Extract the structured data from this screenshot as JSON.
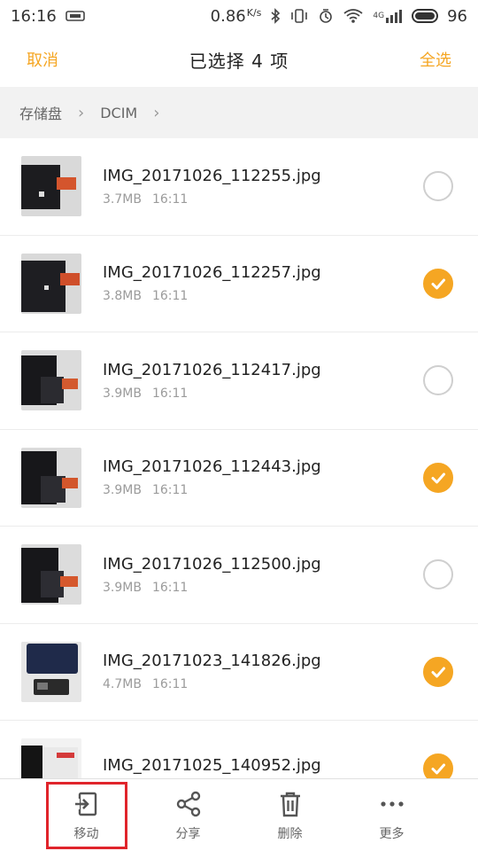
{
  "status_bar": {
    "time": "16:16",
    "speed": "0.86",
    "speed_unit": "K/s",
    "network": "4G",
    "battery": "96"
  },
  "header": {
    "cancel": "取消",
    "title": "已选择 4 项",
    "select_all": "全选"
  },
  "breadcrumb": {
    "root": "存储盘",
    "folder": "DCIM"
  },
  "files": [
    {
      "name": "IMG_20171026_112255.jpg",
      "size": "3.7MB",
      "time": "16:11",
      "checked": false
    },
    {
      "name": "IMG_20171026_112257.jpg",
      "size": "3.8MB",
      "time": "16:11",
      "checked": true
    },
    {
      "name": "IMG_20171026_112417.jpg",
      "size": "3.9MB",
      "time": "16:11",
      "checked": false
    },
    {
      "name": "IMG_20171026_112443.jpg",
      "size": "3.9MB",
      "time": "16:11",
      "checked": true
    },
    {
      "name": "IMG_20171026_112500.jpg",
      "size": "3.9MB",
      "time": "16:11",
      "checked": false
    },
    {
      "name": "IMG_20171023_141826.jpg",
      "size": "4.7MB",
      "time": "16:11",
      "checked": true
    },
    {
      "name": "IMG_20171025_140952.jpg",
      "size": "",
      "time": "",
      "checked": true
    }
  ],
  "toolbar": {
    "move": "移动",
    "share": "分享",
    "delete": "删除",
    "more": "更多"
  },
  "colors": {
    "accent": "#f5a623",
    "highlight": "#e0242b"
  }
}
